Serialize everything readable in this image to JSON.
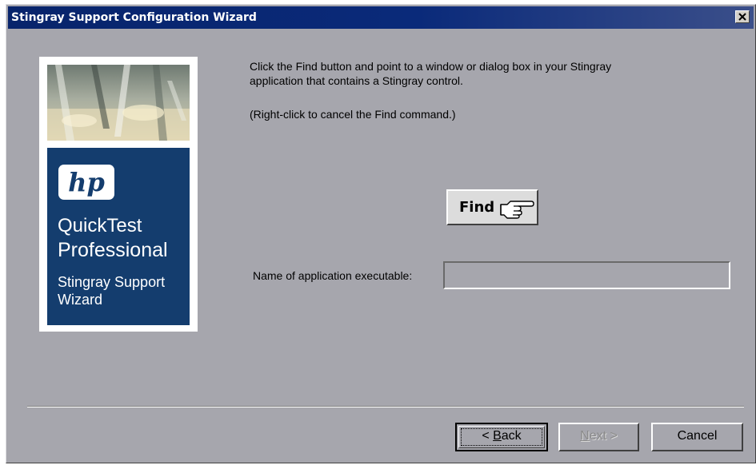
{
  "window": {
    "title": "Stingray Support Configuration Wizard",
    "close_icon": "close-icon"
  },
  "side_panel": {
    "logo_text": "hp",
    "product_line1": "QuickTest",
    "product_line2": "Professional",
    "wizard_line1": "Stingray Support",
    "wizard_line2": "Wizard",
    "brand_color": "#143d6e"
  },
  "instructions": {
    "line1": "Click the Find button and point to a window or dialog box in your Stingray",
    "line2": "application that contains a Stingray control.",
    "line3": "(Right-click to cancel the Find command.)"
  },
  "find_button": {
    "label": "Find",
    "icon": "pointing-hand-icon"
  },
  "exe_field": {
    "label": "Name of application executable:",
    "value": ""
  },
  "buttons": {
    "back": {
      "prefix": "< ",
      "accel": "B",
      "rest": "ack"
    },
    "next": {
      "accel": "N",
      "rest": "ext >"
    },
    "cancel": "Cancel"
  }
}
